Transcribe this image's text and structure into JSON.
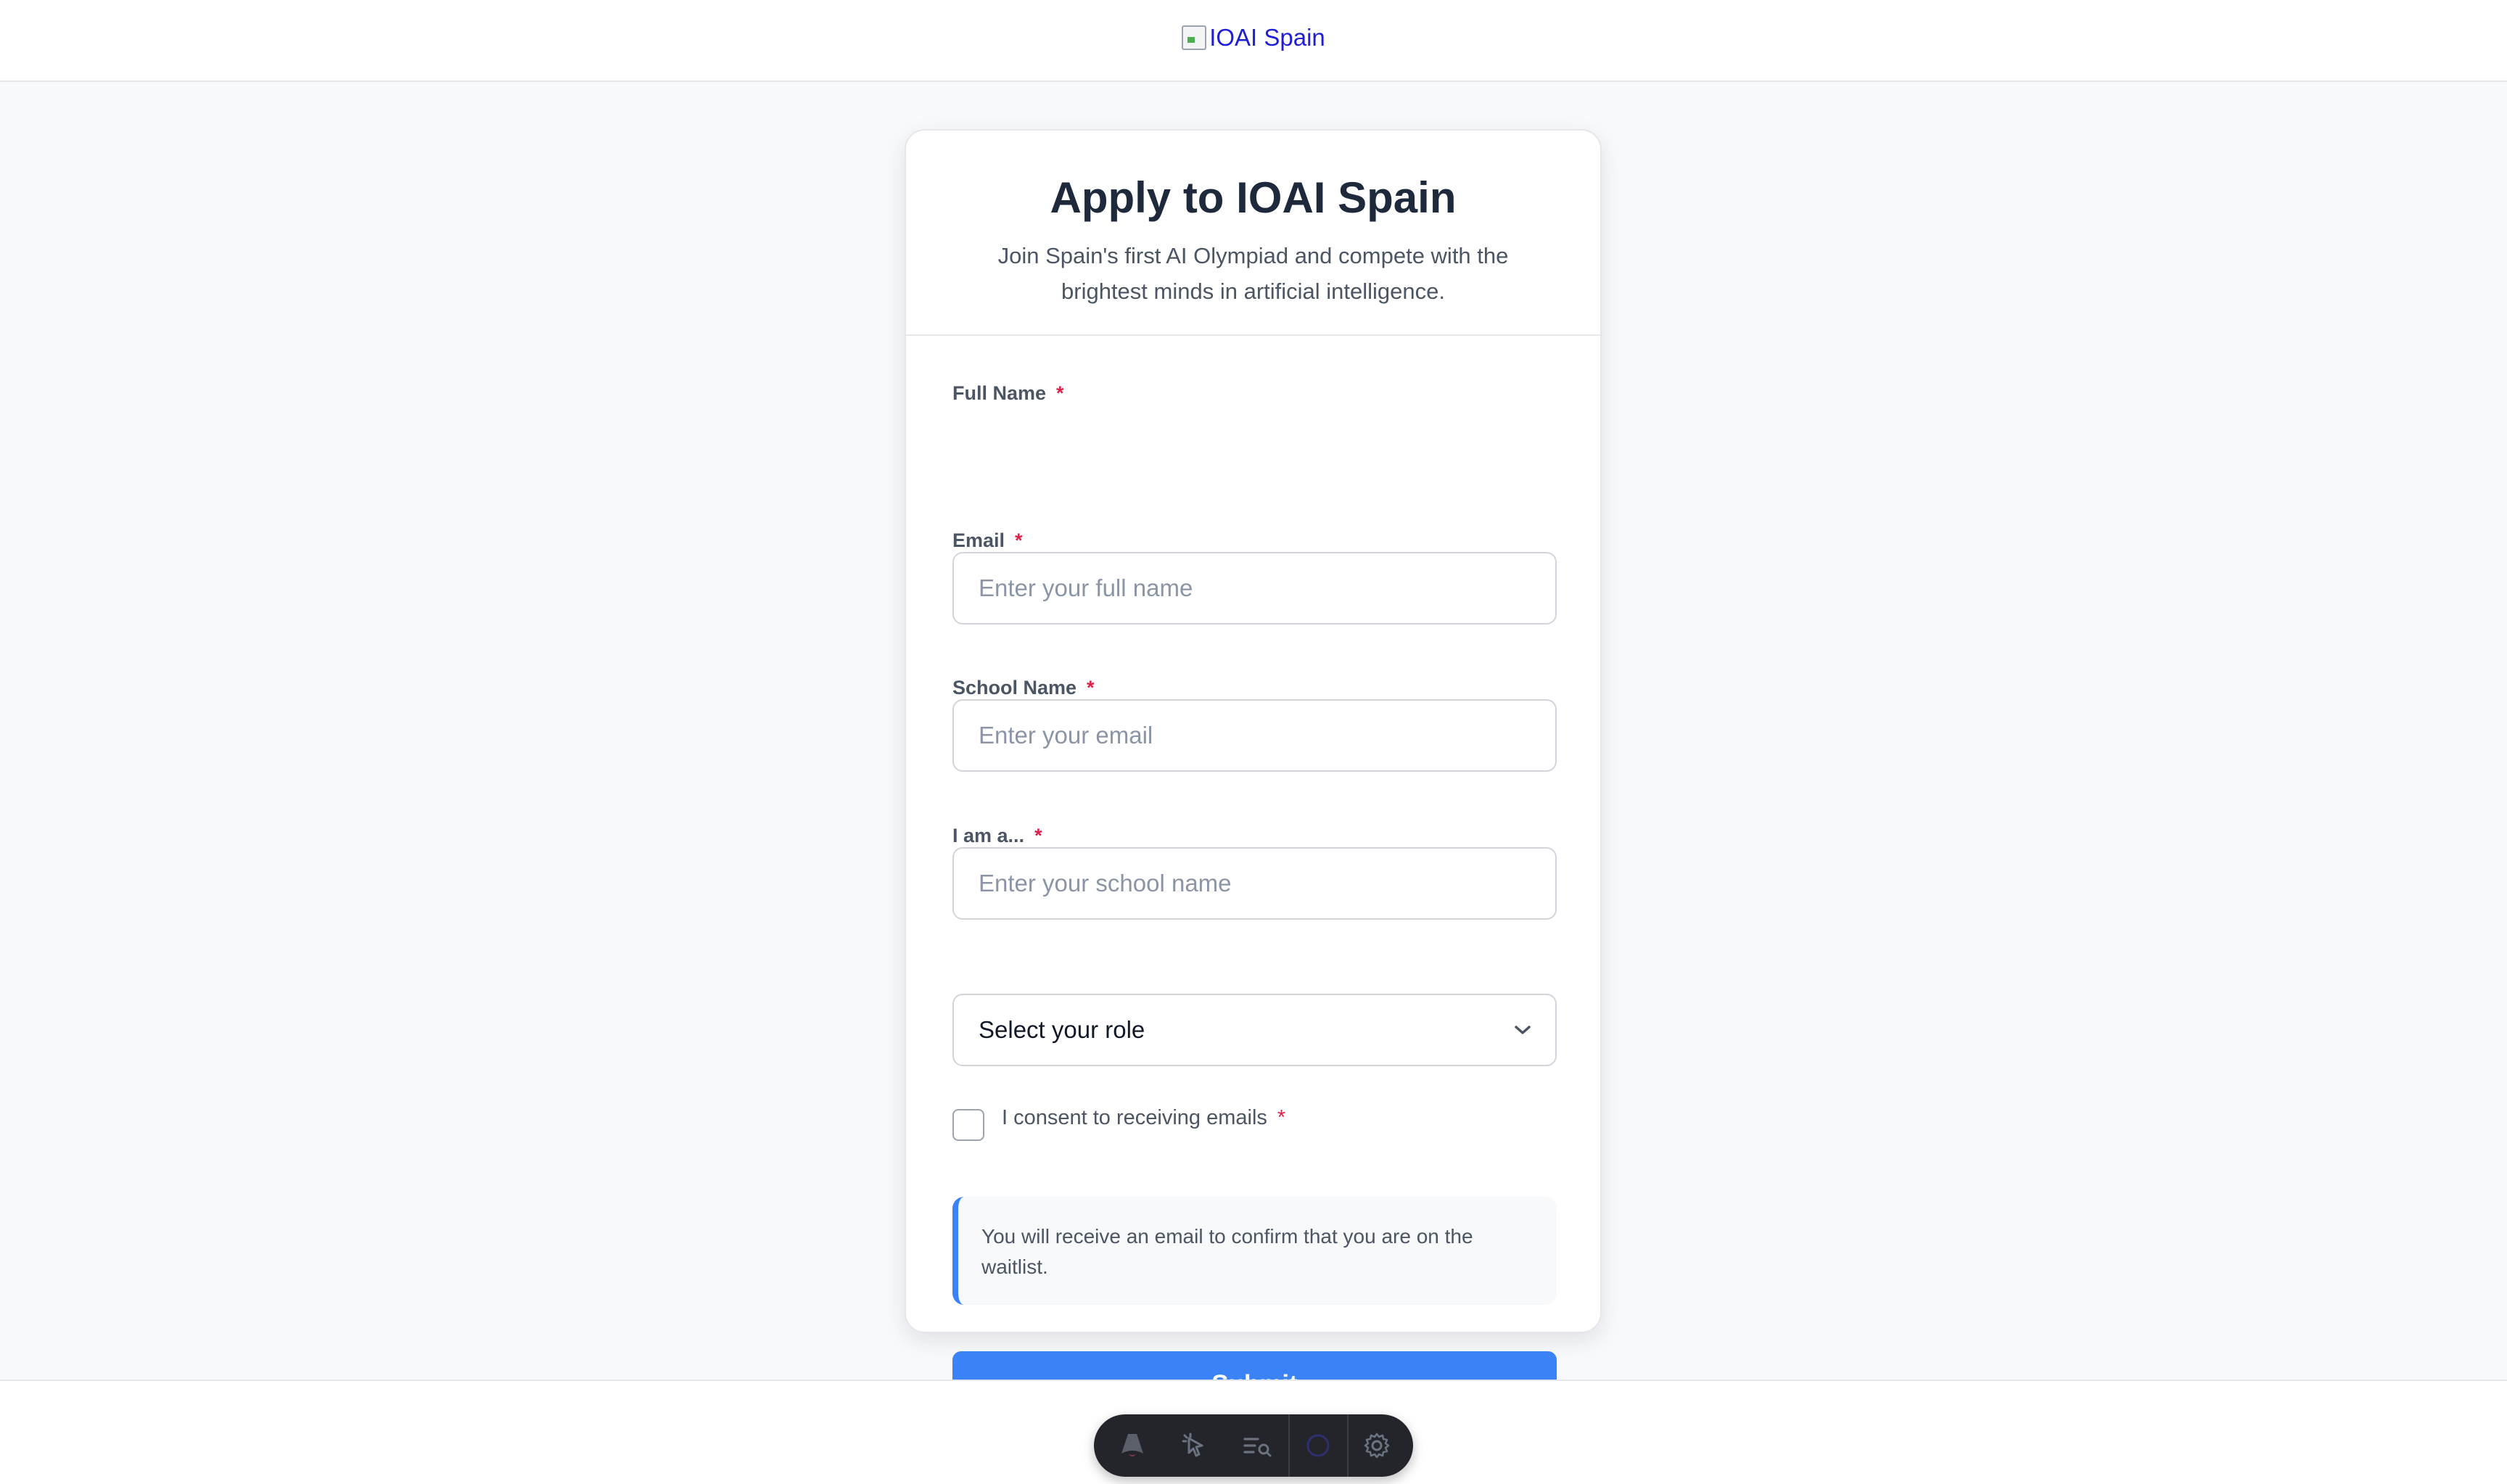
{
  "header": {
    "logo_alt": "IOAI Spain"
  },
  "card": {
    "title": "Apply to IOAI Spain",
    "subtitle": "Join Spain's first AI Olympiad and compete with the brightest minds in artificial intelligence."
  },
  "form": {
    "full_name": {
      "label": "Full Name",
      "required_mark": "*",
      "placeholder": "Enter your full name",
      "value": ""
    },
    "email": {
      "label": "Email",
      "required_mark": "*",
      "placeholder": "Enter your email",
      "value": ""
    },
    "school": {
      "label": "School Name",
      "required_mark": "*",
      "placeholder": "Enter your school name",
      "value": ""
    },
    "role": {
      "label": "I am a...",
      "required_mark": "*",
      "selected": "Select your role"
    },
    "consent": {
      "label": "I consent to receiving emails",
      "required_mark": "*",
      "checked": false
    },
    "info_text": "You will receive an email to confirm that you are on the waitlist.",
    "submit_label": "Submit"
  },
  "dev_toolbar": {
    "icons": [
      "astro-logo-icon",
      "inspect-cursor-icon",
      "audit-list-icon",
      "app-circle-icon",
      "settings-gear-icon"
    ]
  },
  "colors": {
    "accent": "#3b82f6",
    "required": "#e11d48",
    "title": "#1e293b",
    "page_bg": "#f8f9fb"
  }
}
